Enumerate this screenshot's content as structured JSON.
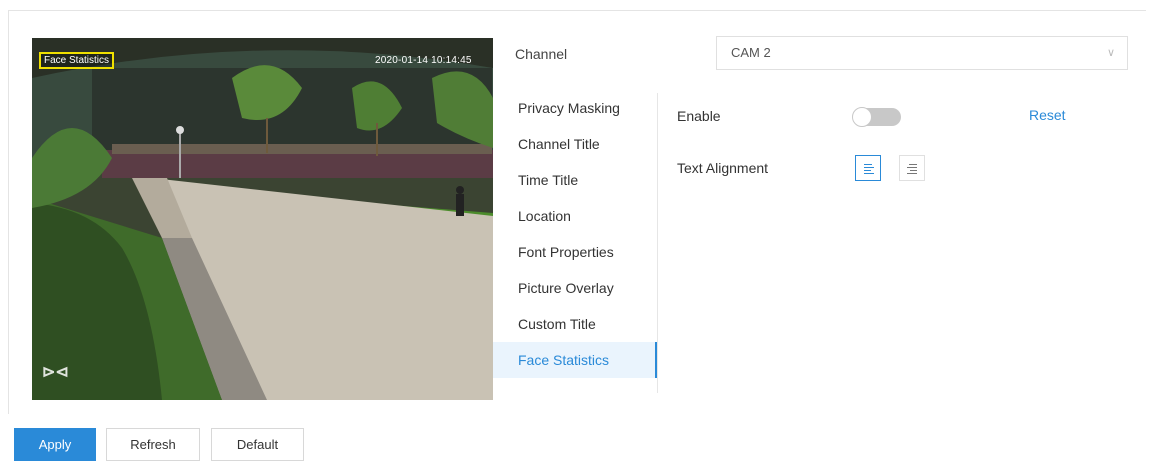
{
  "preview": {
    "osd_title": "Face Statistics",
    "osd_timestamp": "2020-01-14 10:14:45"
  },
  "channel": {
    "label": "Channel",
    "value": "CAM 2"
  },
  "menu": {
    "items": [
      {
        "label": "Privacy Masking"
      },
      {
        "label": "Channel Title"
      },
      {
        "label": "Time Title"
      },
      {
        "label": "Location"
      },
      {
        "label": "Font Properties"
      },
      {
        "label": "Picture Overlay"
      },
      {
        "label": "Custom Title"
      },
      {
        "label": "Face Statistics"
      }
    ],
    "active": "Face Statistics"
  },
  "settings": {
    "enable_label": "Enable",
    "enable_on": false,
    "reset_label": "Reset",
    "text_alignment_label": "Text Alignment",
    "alignment_selected": "left"
  },
  "footer": {
    "apply_label": "Apply",
    "refresh_label": "Refresh",
    "default_label": "Default"
  },
  "colors": {
    "accent": "#2a8ad8",
    "osd_box": "#f0e000"
  }
}
